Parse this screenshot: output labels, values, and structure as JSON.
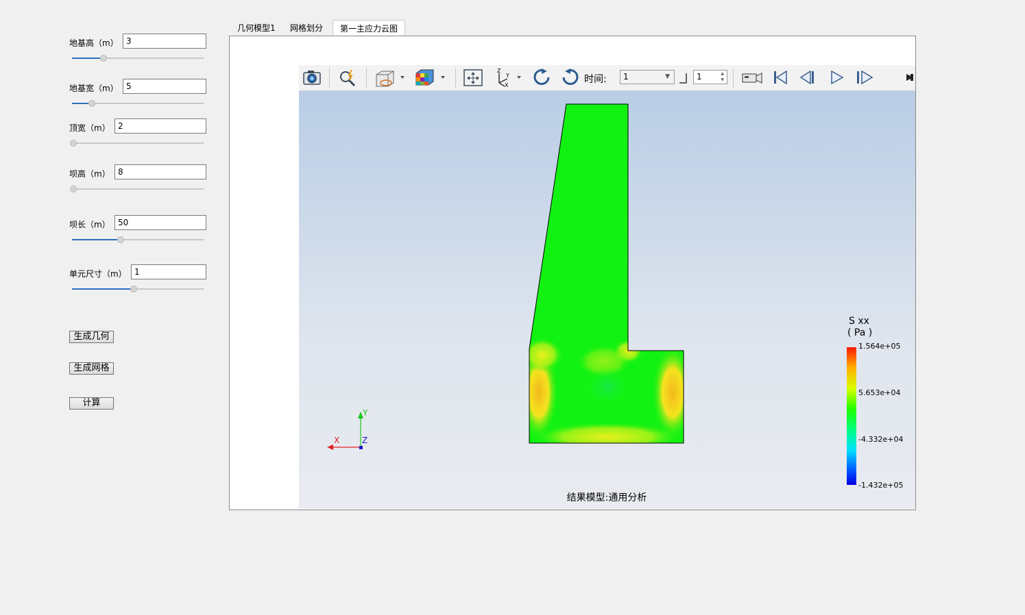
{
  "params": [
    {
      "label": "地基高（m）",
      "value": "3",
      "fill": 0.24
    },
    {
      "label": "地基宽（m）",
      "value": "5",
      "fill": 0.15
    },
    {
      "label": "顶宽（m）",
      "value": "2",
      "fill": 0.0
    },
    {
      "label": "坝高（m）",
      "value": "8",
      "fill": 0.0
    },
    {
      "label": "坝长（m）",
      "value": "50",
      "fill": 0.37
    },
    {
      "label": "单元尺寸（m）",
      "value": "1",
      "fill": 0.47
    }
  ],
  "buttons": {
    "gen_geometry": "生成几何",
    "gen_mesh": "生成网格",
    "compute": "计算"
  },
  "tabs": [
    "几何模型1",
    "网格划分",
    "第一主应力云图"
  ],
  "toolbar": {
    "time_label": "时间:",
    "time_value": "1",
    "step_value": "1"
  },
  "axes": {
    "x": "X",
    "y": "Y",
    "z": "Z"
  },
  "legend": {
    "title": "S xx",
    "unit": "( Pa )",
    "ticks": [
      "1.564e+05",
      "5.653e+04",
      "-4.332e+04",
      "-1.432e+05"
    ]
  },
  "viewport_caption": "结果模型:通用分析",
  "colors": {
    "accent": "#2a6fbf",
    "contour_main": "#12f212",
    "contour_hot": "#f5e21a"
  }
}
